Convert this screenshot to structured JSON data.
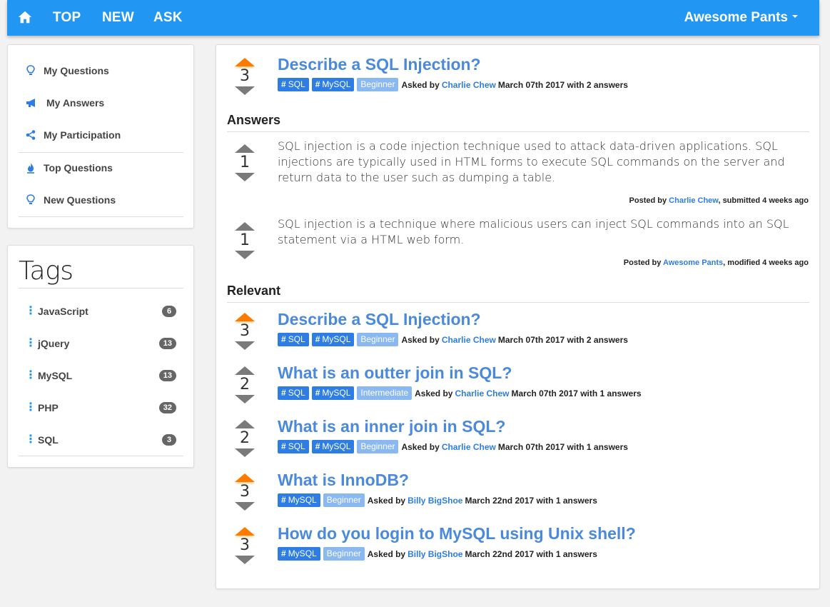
{
  "navbar": {
    "home_icon": "home-icon",
    "links": [
      "TOP",
      "NEW",
      "ASK"
    ],
    "user": "Awesome Pants"
  },
  "sidebar": {
    "items": [
      {
        "label": "My Questions",
        "icon": "lightbulb-icon"
      },
      {
        "label": "My Answers",
        "icon": "megaphone-icon"
      },
      {
        "label": "My Participation",
        "icon": "share-icon"
      },
      {
        "label": "Top Questions",
        "icon": "fire-icon"
      },
      {
        "label": "New Questions",
        "icon": "lightbulb-icon"
      }
    ]
  },
  "tags": {
    "title": "Tags",
    "items": [
      {
        "name": "JavaScript",
        "count": "6"
      },
      {
        "name": "jQuery",
        "count": "13"
      },
      {
        "name": "MySQL",
        "count": "13"
      },
      {
        "name": "PHP",
        "count": "32"
      },
      {
        "name": "SQL",
        "count": "3"
      }
    ]
  },
  "question": {
    "votes": "3",
    "title": "Describe a SQL Injection?",
    "tags": [
      "SQL",
      "MySQL"
    ],
    "level": "Beginner",
    "asked_by_label": "Asked by",
    "author": "Charlie Chew",
    "date_info": "March 07th 2017 with 2 answers"
  },
  "answers_title": "Answers",
  "answers": [
    {
      "votes": "1",
      "text": "SQL injection is a code injection technique used to attack data-driven applications. SQL injections are typically used in HTML forms to execute SQL commands on the server and return data to the user such as dumping a table.",
      "posted_label": "Posted by",
      "author": "Charlie Chew",
      "status": ", submitted 4 weeks ago"
    },
    {
      "votes": "1",
      "text": "SQL injection is a technique where malicious users can inject SQL commands into an SQL statement via a HTML web form.",
      "posted_label": "Posted by",
      "author": "Awesome Pants",
      "status": ", modified 4 weeks ago"
    }
  ],
  "relevant_title": "Relevant",
  "relevant": [
    {
      "votes": "3",
      "title": "Describe a SQL Injection?",
      "tags": [
        "SQL",
        "MySQL"
      ],
      "level": "Beginner",
      "asked_by_label": "Asked by",
      "author": "Charlie Chew",
      "date_info": "March 07th 2017 with 2 answers"
    },
    {
      "votes": "2",
      "title": "What is an outter join in SQL?",
      "tags": [
        "SQL",
        "MySQL"
      ],
      "level": "Intermediate",
      "asked_by_label": "Asked by",
      "author": "Charlie Chew",
      "date_info": "March 07th 2017 with 1 answers"
    },
    {
      "votes": "2",
      "title": "What is an inner join in SQL?",
      "tags": [
        "SQL",
        "MySQL"
      ],
      "level": "Beginner",
      "asked_by_label": "Asked by",
      "author": "Charlie Chew",
      "date_info": "March 07th 2017 with 1 answers"
    },
    {
      "votes": "3",
      "title": "What is InnoDB?",
      "tags": [
        "MySQL"
      ],
      "level": "Beginner",
      "asked_by_label": "Asked by",
      "author": "Billy BigShoe",
      "date_info": "March 22nd 2017 with 1 answers"
    },
    {
      "votes": "3",
      "title": "How do you login to MySQL using Unix shell?",
      "tags": [
        "MySQL"
      ],
      "level": "Beginner",
      "asked_by_label": "Asked by",
      "author": "Billy BigShoe",
      "date_info": "March 22nd 2017 with 1 answers"
    }
  ],
  "colors": {
    "primary": "#2196f3",
    "link": "#4a89dc",
    "badge": "#2d7de4",
    "badge_level": "#8ab8f0",
    "hot_vote": "#ff7a00"
  }
}
